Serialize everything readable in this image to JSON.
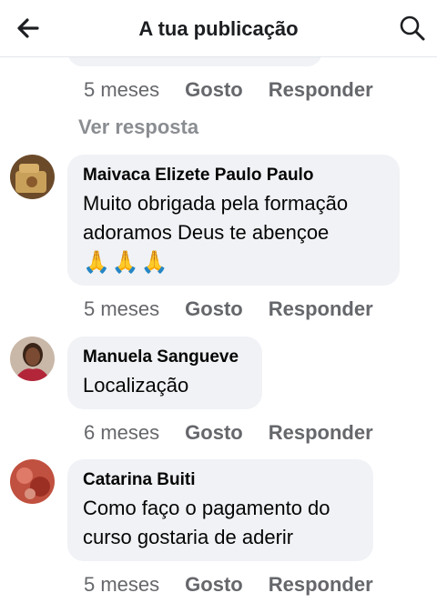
{
  "header": {
    "title": "A tua publicação",
    "back_icon": "arrow-left-icon",
    "search_icon": "search-icon"
  },
  "previous_comment": {
    "time": "5 meses",
    "like_label": "Gosto",
    "reply_label": "Responder",
    "see_replies": "Ver resposta"
  },
  "comments": [
    {
      "author": "Maivaca Elizete Paulo Paulo",
      "text": "Muito obrigada pela formação\nadoramos Deus te abençoe",
      "emoji": "🙏🙏🙏",
      "time": "5 meses",
      "like_label": "Gosto",
      "reply_label": "Responder"
    },
    {
      "author": "Manuela Sangueve",
      "text": "Localização",
      "time": "6 meses",
      "like_label": "Gosto",
      "reply_label": "Responder"
    },
    {
      "author": "Catarina Buiti",
      "text": "Como faço o pagamento do\ncurso gostaria de aderir",
      "time": "5 meses",
      "like_label": "Gosto",
      "reply_label": "Responder"
    }
  ],
  "colors": {
    "bubble": "#f0f2f5",
    "meta_text": "#65676b",
    "see_replies": "#8a8d91"
  }
}
